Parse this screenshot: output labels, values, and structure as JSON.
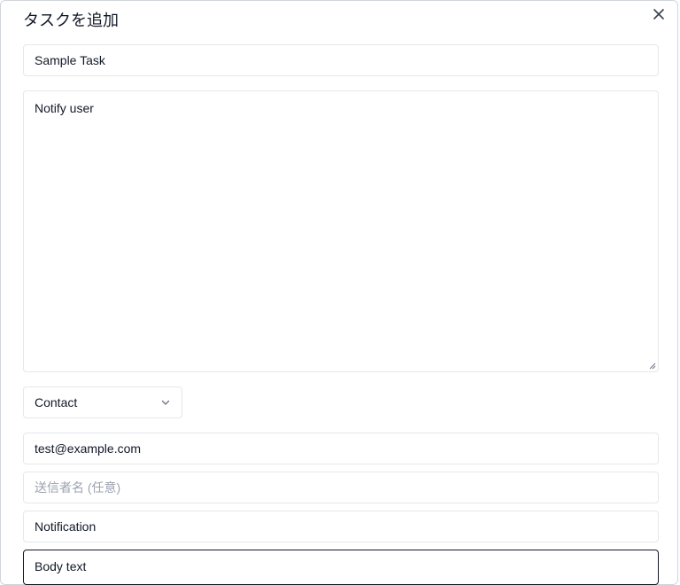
{
  "modal": {
    "title": "タスクを追加",
    "close_icon": "close-icon"
  },
  "form": {
    "task_name_value": "Sample Task",
    "description_value": "Notify user",
    "type_select_value": "Contact",
    "email_value": "test@example.com",
    "sender_name_placeholder": "送信者名 (任意)",
    "subject_value": "Notification",
    "body_value": "Body text"
  },
  "icons": {
    "chevron": "chevron-down-icon",
    "resize": "resize-handle-icon"
  }
}
